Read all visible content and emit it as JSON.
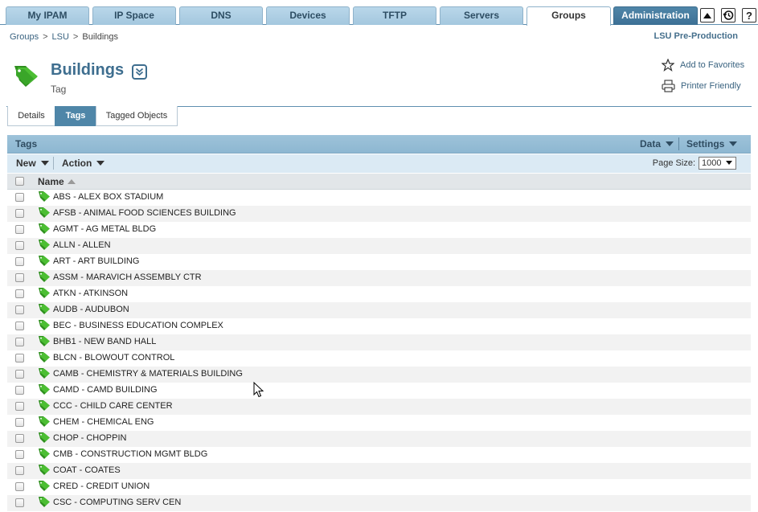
{
  "nav": {
    "tabs": [
      "My IPAM",
      "IP Space",
      "DNS",
      "Devices",
      "TFTP",
      "Servers",
      "Groups",
      "Administration"
    ],
    "active_tab": "Groups"
  },
  "breadcrumb": [
    "Groups",
    "LSU",
    "Buildings"
  ],
  "environment": "LSU Pre-Production",
  "header": {
    "title": "Buildings",
    "subtitle": "Tag",
    "favorites": "Add to Favorites",
    "printer": "Printer Friendly"
  },
  "subtabs": [
    "Details",
    "Tags",
    "Tagged Objects"
  ],
  "active_subtab": "Tags",
  "panel": {
    "title": "Tags",
    "data_menu": "Data",
    "settings_menu": "Settings",
    "new_label": "New",
    "action_label": "Action",
    "page_size_label": "Page Size:",
    "page_size_value": "1000",
    "column_name": "Name"
  },
  "tags": [
    "ABS - ALEX BOX STADIUM",
    "AFSB - ANIMAL FOOD SCIENCES BUILDING",
    "AGMT - AG METAL BLDG",
    "ALLN - ALLEN",
    "ART - ART BUILDING",
    "ASSM - MARAVICH ASSEMBLY CTR",
    "ATKN - ATKINSON",
    "AUDB - AUDUBON",
    "BEC - BUSINESS EDUCATION COMPLEX",
    "BHB1 - NEW BAND HALL",
    "BLCN - BLOWOUT CONTROL",
    "CAMB - CHEMISTRY & MATERIALS BUILDING",
    "CAMD - CAMD BUILDING",
    "CCC - CHILD CARE CENTER",
    "CHEM - CHEMICAL ENG",
    "CHOP - CHOPPIN",
    "CMB - CONSTRUCTION MGMT BLDG",
    "COAT - COATES",
    "CRED - CREDIT UNION",
    "CSC - COMPUTING SERV CEN"
  ],
  "colors": {
    "accent": "#4f86a8",
    "tab_bg": "#a4c7de",
    "panel_head": "#8db7d1",
    "tag_icon": "#3fae2a"
  }
}
